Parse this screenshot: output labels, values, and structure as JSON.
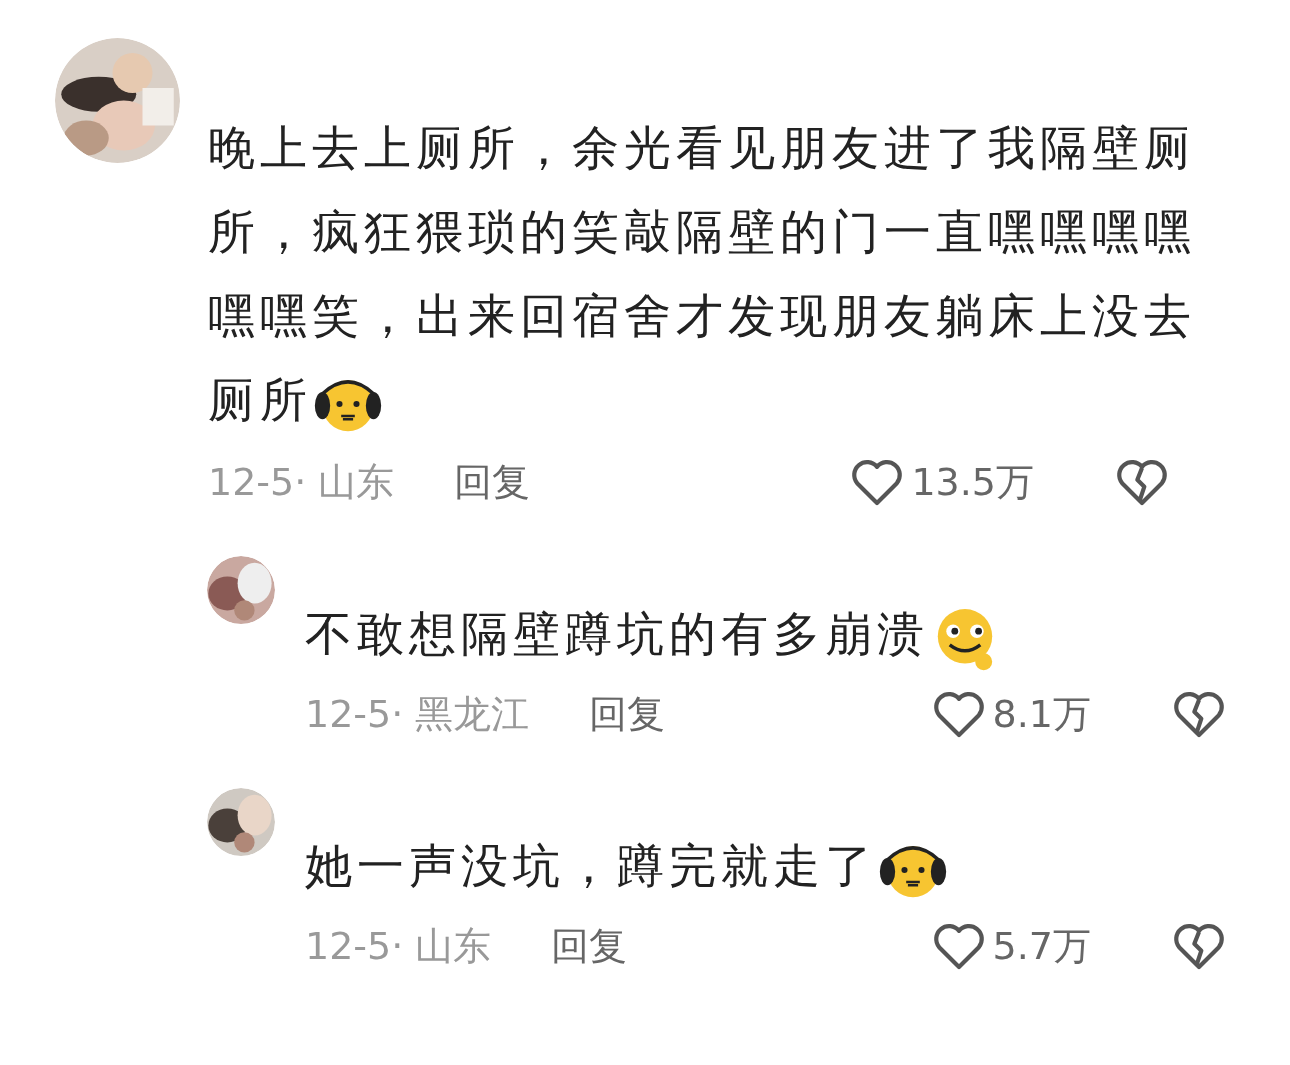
{
  "comments": [
    {
      "text": "晚上去上厕所，余光看见朋友进了我隔壁厕所，疯狂猥琐的笑敲隔壁的门一直嘿嘿嘿嘿嘿嘿笑，出来回宿舍才发现朋友躺床上没去厕所",
      "emoji": {
        "kind": "earmuffs"
      },
      "date": "12-5·",
      "location": "山东",
      "reply": "回复",
      "likes": "13.5万",
      "replies": [
        {
          "text": "不敢想隔壁蹲坑的有多崩溃",
          "emoji": {
            "kind": "smile"
          },
          "date": "12-5·",
          "location": "黑龙江",
          "reply": "回复",
          "likes": "8.1万"
        },
        {
          "text": "她一声没坑，蹲完就走了",
          "emoji": {
            "kind": "earmuffs"
          },
          "date": "12-5·",
          "location": "山东",
          "reply": "回复",
          "likes": "5.7万"
        }
      ]
    }
  ]
}
